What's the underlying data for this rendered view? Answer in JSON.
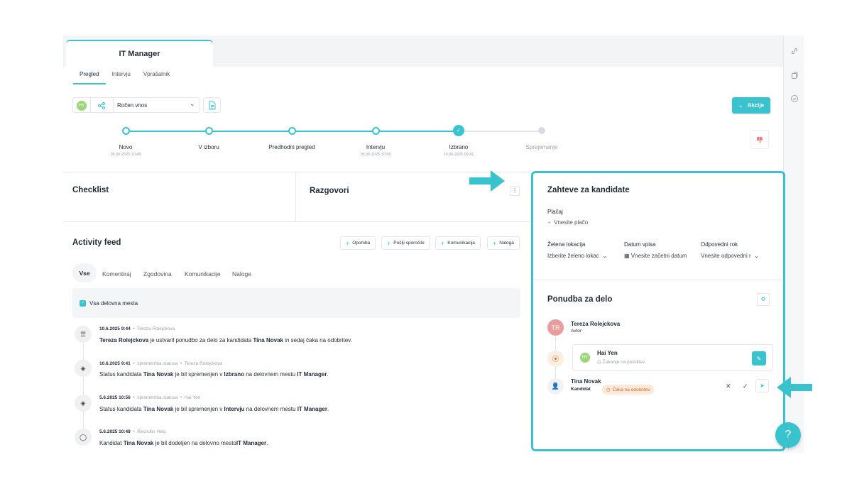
{
  "header": {
    "job_title": "IT Manager",
    "subtabs": [
      "Pregled",
      "Intervju",
      "Vprašalnik"
    ]
  },
  "toolbar": {
    "avatar_initials": "HY",
    "select_value": "Ročen vnos",
    "actions_label": "Akcije"
  },
  "pipeline": [
    {
      "label": "Novo",
      "date": "05.06.2025 10:48"
    },
    {
      "label": "V izboru",
      "date": ""
    },
    {
      "label": "Predhodni pregled",
      "date": ""
    },
    {
      "label": "Intervju",
      "date": "05.06.2025 10:56"
    },
    {
      "label": "Izbrano",
      "date": "10.06.2025 09:41"
    },
    {
      "label": "Sprejemanje",
      "date": ""
    }
  ],
  "sections": {
    "checklist": "Checklist",
    "razgovori": "Razgovori",
    "activity": "Activity feed"
  },
  "activity_buttons": [
    "Opomba",
    "Pošlji sporočilo",
    "Komunikacija",
    "Naloga"
  ],
  "activity_tabs": [
    "Vse",
    "Komentiraj",
    "Zgodovina",
    "Komunikacije",
    "Naloge"
  ],
  "filter_label": "Vsa delovna mesta",
  "events": [
    {
      "when": "10.6.2025 9:44",
      "type": "",
      "author": "Tereza Rolejckova",
      "text_a": "Tereza Rolejckova",
      "text_b": " je ustvaril ponudbo za delo za kandidata ",
      "text_c": "Tina Novak",
      "text_d": " in sedaj čaka na odobritev.",
      "text_e": "",
      "text_f": ""
    },
    {
      "when": "10.6.2025 9:41",
      "type": "sprememba statusa",
      "author": "Tereza Rolejckova",
      "text_a": "Status kandidata ",
      "text_b": "Tina Novak",
      "text_c": " je bil spremenjen v ",
      "text_d": "Izbrano",
      "text_e": " na delovnem mestu ",
      "text_f": "IT Manager"
    },
    {
      "when": "5.6.2025 10:56",
      "type": "sprememba statusa",
      "author": "Hai Yen",
      "text_a": "Status kandidata ",
      "text_b": "Tina Novak",
      "text_c": " je bil spremenjen v ",
      "text_d": "Intervju",
      "text_e": " na delovnem mestu ",
      "text_f": "IT Manager"
    },
    {
      "when": "5.6.2025 10:48",
      "type": "",
      "author": "Recruitis Help",
      "text_a": "Kandidat ",
      "text_b": "Tina Novak",
      "text_c": " je bil dodeljen na delovno mesto",
      "text_d": "IT Manager",
      "text_e": ".",
      "text_f": ""
    }
  ],
  "requirements": {
    "title": "Zahteve za kandidate",
    "salary_label": "Plačaj",
    "salary_placeholder": "Vnesite plačo",
    "location_label": "Želena lokacija",
    "location_value": "Izberite želeno lokac",
    "date_label": "Datum vpisa",
    "date_value": "Vnesite začetni datum",
    "deadline_label": "Odpovedni rok",
    "deadline_value": "Vnesite odpovedni r"
  },
  "offer": {
    "title": "Ponudba za delo",
    "author_initials": "TR",
    "author_name": "Tereza Rolejckova",
    "author_role": "Avtor",
    "approver_initials": "HY",
    "approver_name": "Hai Yen",
    "approver_status": "Čakanje na potrditev",
    "candidate_name": "Tina Novak",
    "candidate_role": "Kandidat",
    "candidate_status": "Čaka na odobritev"
  },
  "help_label": "?",
  "colors": {
    "accent": "#39c3cf",
    "warning": "#d9692a",
    "danger": "#f17b7b"
  }
}
